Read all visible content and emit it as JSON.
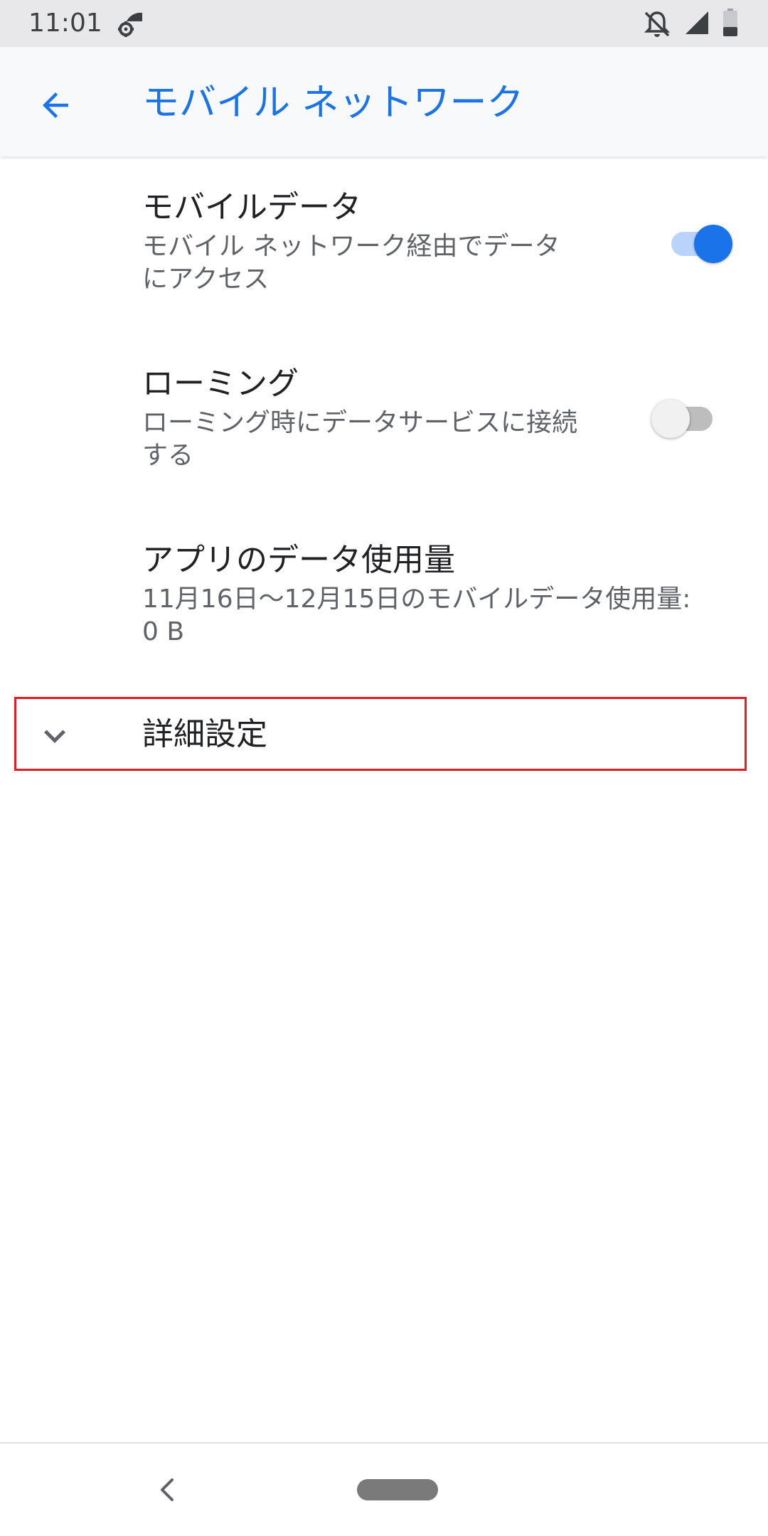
{
  "status_bar": {
    "time": "11:01",
    "icons": [
      "settings-wifi-icon",
      "notifications-off-icon",
      "signal-icon",
      "battery-icon"
    ]
  },
  "app_bar": {
    "back_icon": "arrow-back-icon",
    "title": "モバイル ネットワーク",
    "accent_color": "#1a73e8"
  },
  "preferences": [
    {
      "title": "モバイルデータ",
      "summary_line1": "モバイル ネットワーク経由でデータ",
      "summary_line2": "にアクセス",
      "toggle": "on"
    },
    {
      "title": "ローミング",
      "summary_line1": "ローミング時にデータサービスに接続",
      "summary_line2": "する",
      "toggle": "off"
    },
    {
      "title": "アプリのデータ使用量",
      "summary_line1": "11月16日〜12月15日のモバイルデータ使用量:",
      "summary_line2": "0 B"
    }
  ],
  "advanced": {
    "icon": "chevron-down-icon",
    "label": "詳細設定",
    "highlight_color": "#e01e25"
  },
  "nav_bar": {
    "back_icon": "nav-back-icon",
    "home_icon": "home-pill-icon"
  }
}
